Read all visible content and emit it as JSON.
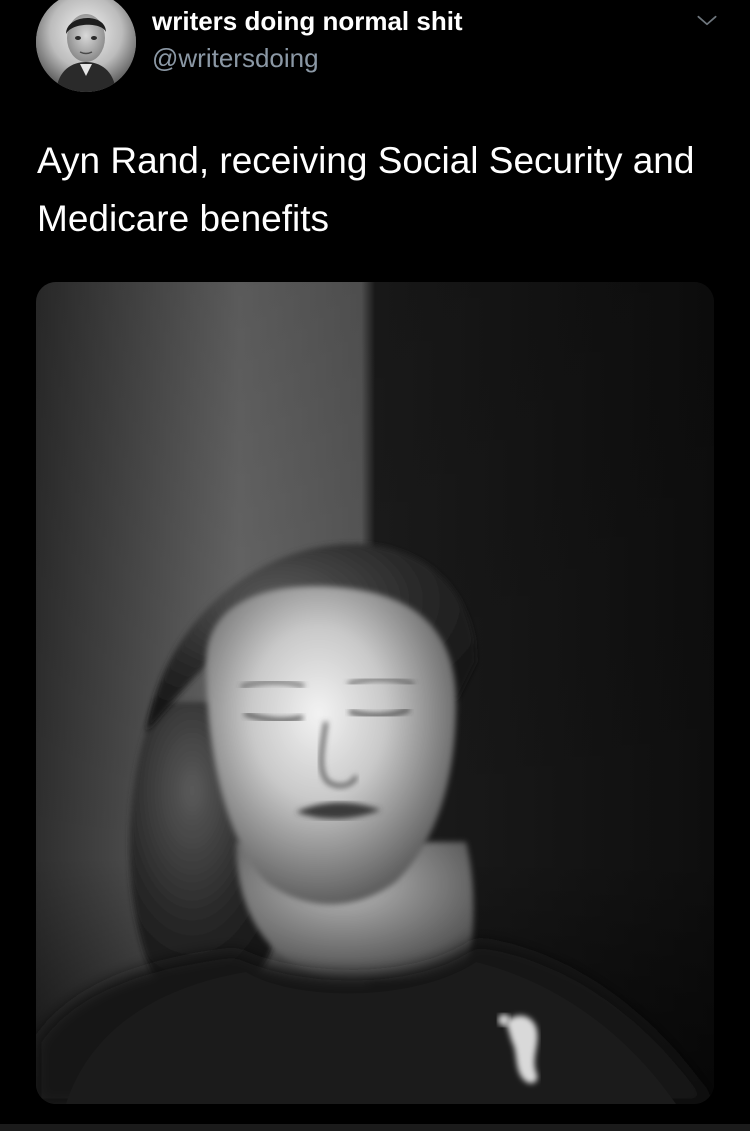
{
  "tweet": {
    "author": {
      "display_name": "writers doing normal shit",
      "handle": "@writersdoing",
      "avatar_icon": "profile-photo-avatar"
    },
    "menu_icon": "chevron-down-icon",
    "text": "Ayn Rand, receiving Social Security and Medicare benefits",
    "media": {
      "kind": "black-and-white portrait photo",
      "icon": "photo"
    }
  },
  "colors": {
    "background": "#000000",
    "primary_text": "#ffffff",
    "secondary_text": "#8b98a5"
  }
}
